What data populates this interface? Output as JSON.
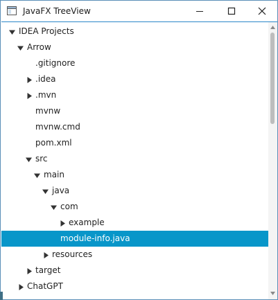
{
  "window": {
    "title": "JavaFX TreeView",
    "controls": [
      "minimize-icon",
      "maximize-icon",
      "close-icon"
    ]
  },
  "tree": {
    "items": [
      {
        "label": "IDEA Projects",
        "expanded": true,
        "has_children": true
      },
      {
        "label": "Arrow",
        "expanded": true,
        "has_children": true
      },
      {
        "label": ".gitignore",
        "has_children": false
      },
      {
        "label": ".idea",
        "expanded": false,
        "has_children": true
      },
      {
        "label": ".mvn",
        "expanded": false,
        "has_children": true
      },
      {
        "label": "mvnw",
        "has_children": false
      },
      {
        "label": "mvnw.cmd",
        "has_children": false
      },
      {
        "label": "pom.xml",
        "has_children": false
      },
      {
        "label": "src",
        "expanded": true,
        "has_children": true
      },
      {
        "label": "main",
        "expanded": true,
        "has_children": true
      },
      {
        "label": "java",
        "expanded": true,
        "has_children": true
      },
      {
        "label": "com",
        "expanded": true,
        "has_children": true
      },
      {
        "label": "example",
        "expanded": false,
        "has_children": true
      },
      {
        "label": "module-info.java",
        "has_children": false,
        "selected": true
      },
      {
        "label": "resources",
        "expanded": false,
        "has_children": true
      },
      {
        "label": "target",
        "expanded": false,
        "has_children": true
      },
      {
        "label": "ChatGPT",
        "expanded": false,
        "has_children": true
      }
    ]
  },
  "colors": {
    "selection": "#0896c9",
    "focus_border": "#2a86c8"
  }
}
